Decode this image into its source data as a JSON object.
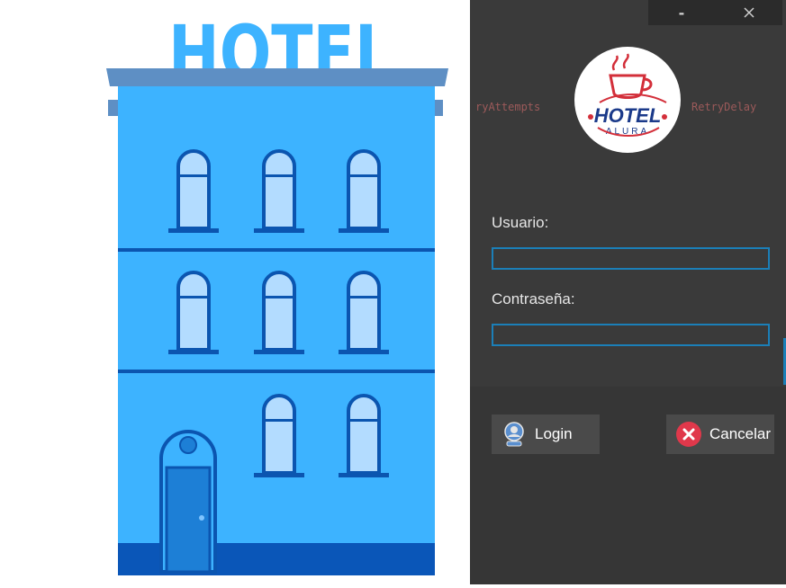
{
  "window": {
    "minimize_symbol": "-",
    "close_symbol": "X"
  },
  "logo": {
    "line1": "HOTEL",
    "line2": "ALURA"
  },
  "hero": {
    "sign_text": "HOTEL"
  },
  "background_code": {
    "left_fragment": "ryAttempts",
    "right_fragment": "RetryDelay"
  },
  "form": {
    "username_label": "Usuario:",
    "username_value": "",
    "password_label": "Contraseña:",
    "password_value": ""
  },
  "buttons": {
    "login_label": "Login",
    "cancel_label": "Cancelar"
  },
  "colors": {
    "panel_bg": "#3a3a3a",
    "field_border": "#1b7fb8",
    "building_blue": "#3db3ff",
    "cancel_red": "#e0384b"
  }
}
